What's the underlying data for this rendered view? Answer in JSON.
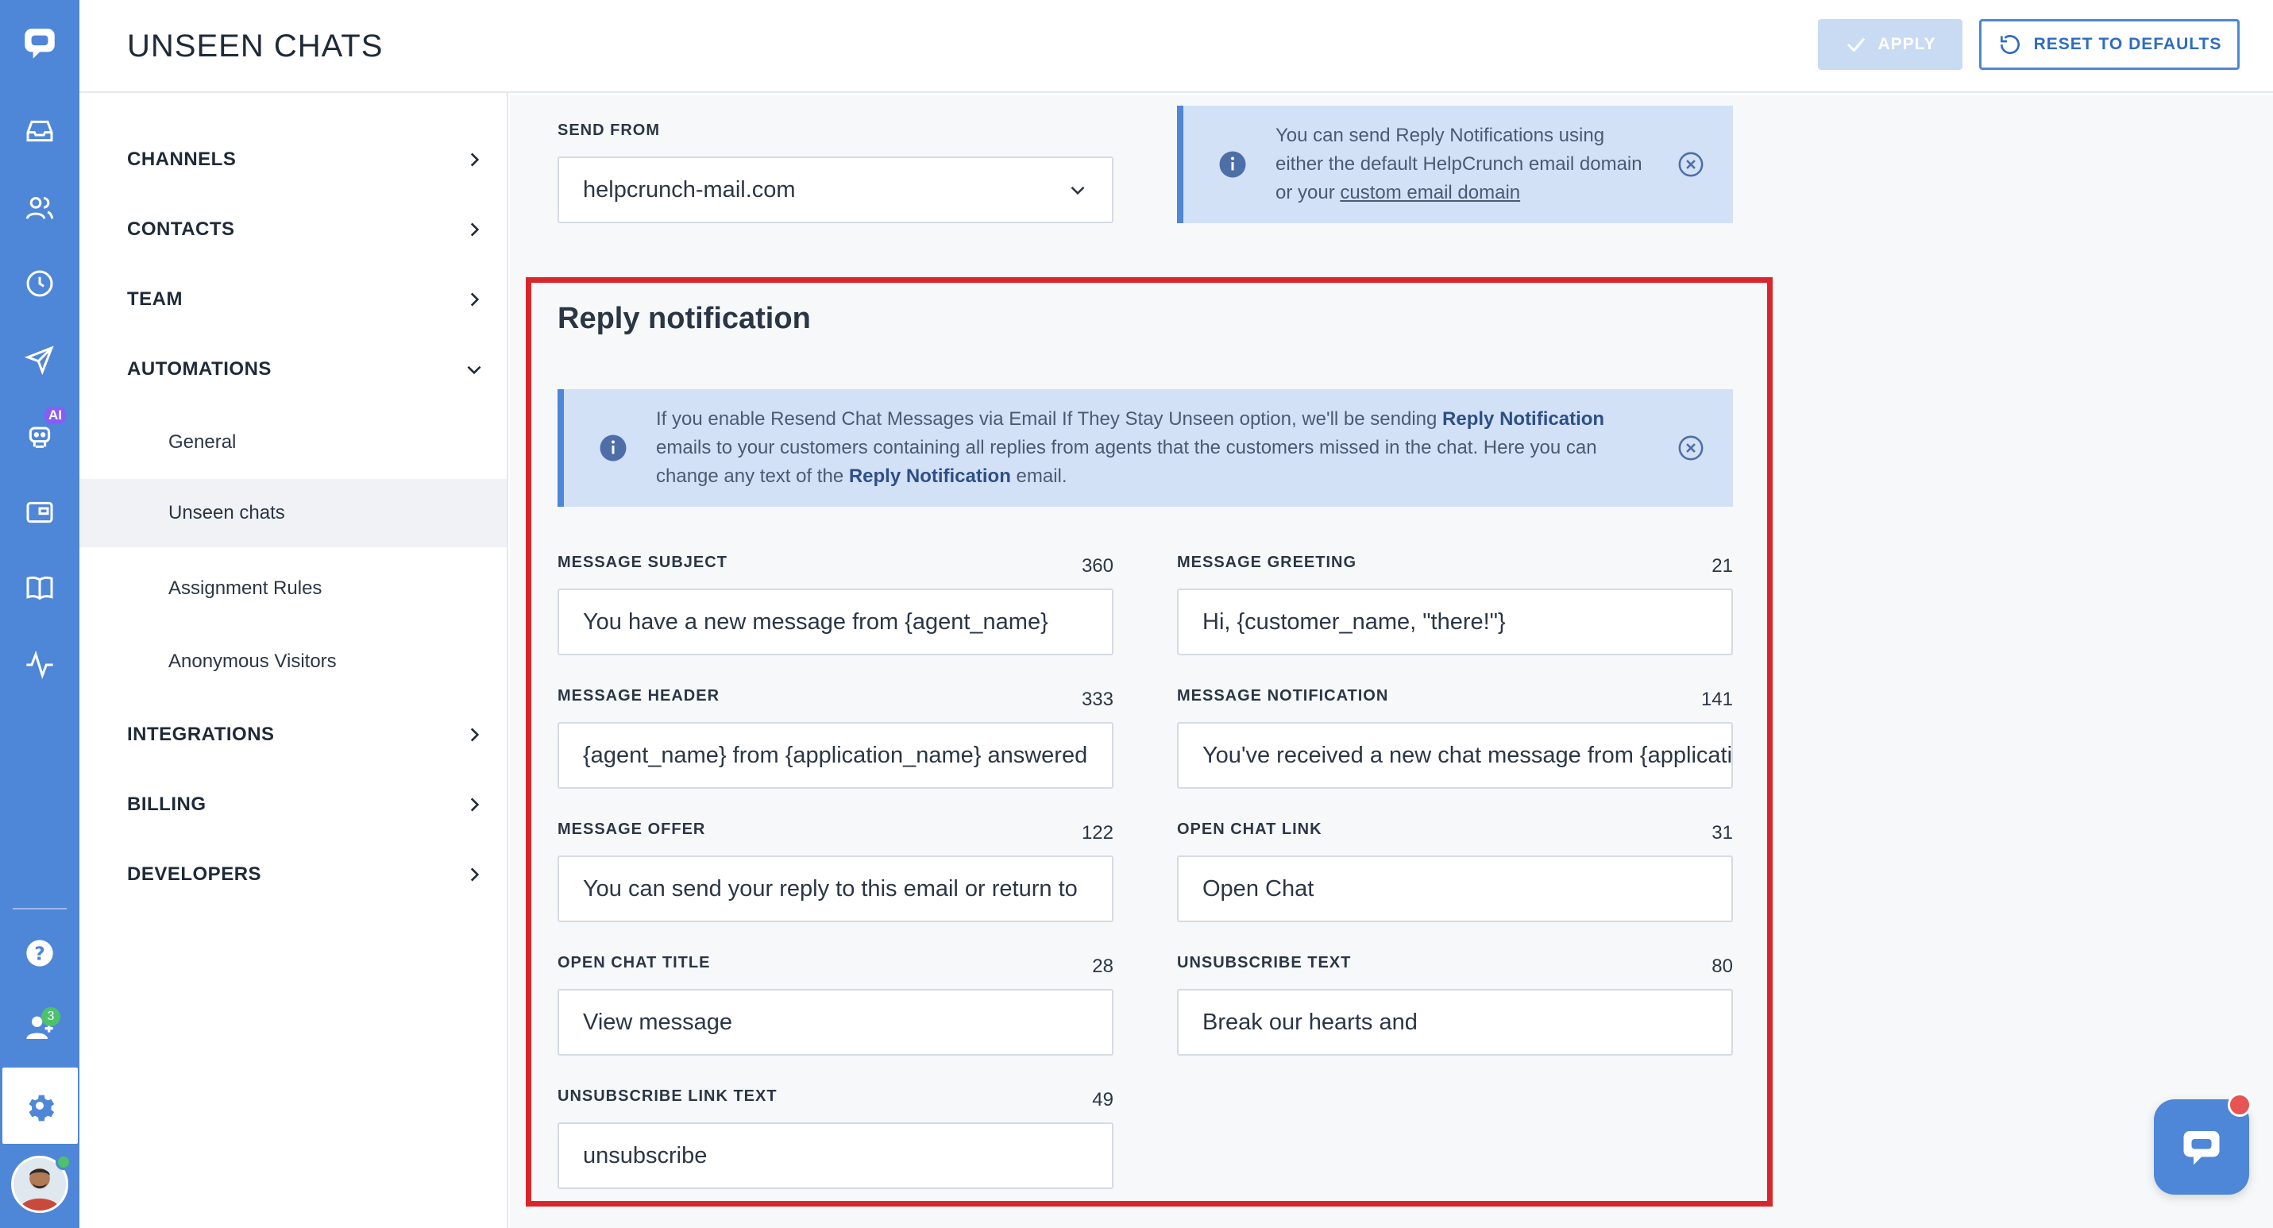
{
  "header": {
    "title": "UNSEEN CHATS",
    "apply_label": "APPLY",
    "reset_label": "RESET TO DEFAULTS"
  },
  "rail": {
    "ai_badge": "AI",
    "team_count": "3"
  },
  "nav": {
    "channels": "CHANNELS",
    "contacts": "CONTACTS",
    "team": "TEAM",
    "automations": "AUTOMATIONS",
    "automations_items": [
      "General",
      "Unseen chats",
      "Assignment Rules",
      "Anonymous Visitors"
    ],
    "integrations": "INTEGRATIONS",
    "billing": "BILLING",
    "developers": "DEVELOPERS"
  },
  "send_from": {
    "label": "SEND FROM",
    "value": "helpcrunch-mail.com"
  },
  "domain_info": {
    "text": "You can send Reply Notifications using either the default HelpCrunch email domain or your ",
    "link": "custom email domain"
  },
  "reply_notification": {
    "title": "Reply notification",
    "info": {
      "part1": "If you enable Resend Chat Messages via Email If They Stay Unseen option, we'll be sending ",
      "bold1": "Reply Notification",
      "part2": " emails to your customers containing all replies from agents that the customers missed in the chat. Here you can change any text of the ",
      "bold2": "Reply Notification",
      "part3": " email."
    },
    "fields": {
      "message_subject": {
        "label": "MESSAGE SUBJECT",
        "count": "360",
        "value": "You have a new message from {agent_name}"
      },
      "message_greeting": {
        "label": "MESSAGE GREETING",
        "count": "21",
        "value": "Hi, {customer_name, \"there!\"}"
      },
      "message_header": {
        "label": "MESSAGE HEADER",
        "count": "333",
        "value": "{agent_name} from {application_name} answered"
      },
      "message_notification": {
        "label": "MESSAGE NOTIFICATION",
        "count": "141",
        "value": "You've received a new chat message from {application_name}"
      },
      "message_offer": {
        "label": "MESSAGE OFFER",
        "count": "122",
        "value": "You can send your reply to this email or return to"
      },
      "open_chat_link": {
        "label": "OPEN CHAT LINK",
        "count": "31",
        "value": "Open Chat"
      },
      "open_chat_title": {
        "label": "OPEN CHAT TITLE",
        "count": "28",
        "value": "View message"
      },
      "unsubscribe_text": {
        "label": "UNSUBSCRIBE TEXT",
        "count": "80",
        "value": "Break our hearts and"
      },
      "unsubscribe_link_text": {
        "label": "UNSUBSCRIBE LINK TEXT",
        "count": "49",
        "value": "unsubscribe"
      }
    }
  },
  "colors": {
    "rail": "#4e86d8",
    "accent": "#2e6cc4",
    "highlight_border": "#d9262c",
    "info_bg": "#d2e1f6"
  },
  "icons": [
    "chat-logo-icon",
    "inbox-icon",
    "contacts-icon",
    "clock-icon",
    "send-icon",
    "ai-bot-icon",
    "card-icon",
    "book-icon",
    "activity-icon",
    "help-icon",
    "team-icon",
    "gear-icon",
    "check-icon",
    "reset-icon",
    "chevron-right-icon",
    "chevron-down-icon",
    "info-icon",
    "close-circle-icon",
    "chat-launcher-icon"
  ]
}
